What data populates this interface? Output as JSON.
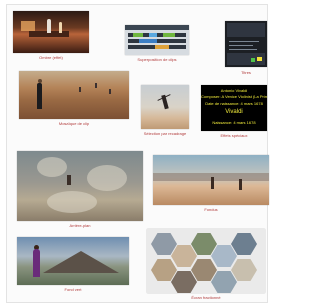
{
  "thumbnails": [
    {
      "id": "night",
      "caption": "Ombre (effet)"
    },
    {
      "id": "timeline",
      "caption": "Superposition de clips"
    },
    {
      "id": "titles",
      "caption": "Titres"
    },
    {
      "id": "desert",
      "caption": "Mosaïque de clip"
    },
    {
      "id": "beach",
      "caption": "Sélection par recadrage"
    },
    {
      "id": "credits",
      "caption": "Effets spéciaux"
    },
    {
      "id": "blur",
      "caption": "Arrière-plan"
    },
    {
      "id": "fade",
      "caption": "Fondus"
    },
    {
      "id": "key",
      "caption": "Fond vert"
    },
    {
      "id": "hex",
      "caption": "Écran fractionné"
    }
  ],
  "credits_text": {
    "line1": "Antonio Vivaldi",
    "line2": "Composer: A Venice Violinist (La Primavera)",
    "line3": "Date de naissance: 4 mars 1678",
    "line4": "Vivaldi",
    "line5": "Naissance: 4 mars 1678"
  },
  "colors": {
    "caption": "#b13a3a",
    "credits": "#f2ec3b"
  }
}
